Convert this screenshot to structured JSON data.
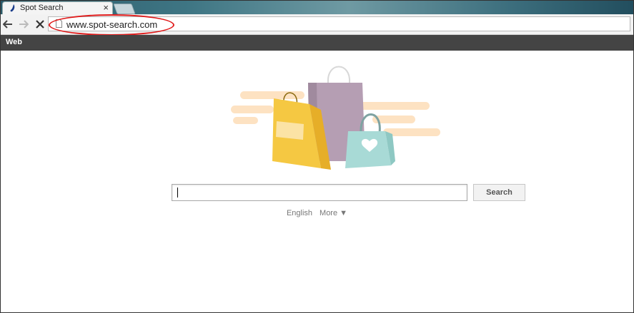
{
  "browser": {
    "tab_title": "Spot Search",
    "tab_close": "×",
    "url": "www.spot-search.com"
  },
  "nav": {
    "back_icon": "arrow-left-icon",
    "forward_icon": "arrow-right-icon",
    "stop_icon": "close-icon",
    "page_icon": "document-icon"
  },
  "webbar": {
    "label": "Web"
  },
  "search": {
    "input_value": "",
    "button_label": "Search"
  },
  "links": {
    "language": "English",
    "more": "More ▼"
  },
  "colors": {
    "highlight": "#e01a1a",
    "webbar": "#444444",
    "bag_yellow": "#f5c842",
    "bag_purple": "#b59eb3",
    "bag_teal": "#a8dad6",
    "streak": "#fde2c2"
  }
}
